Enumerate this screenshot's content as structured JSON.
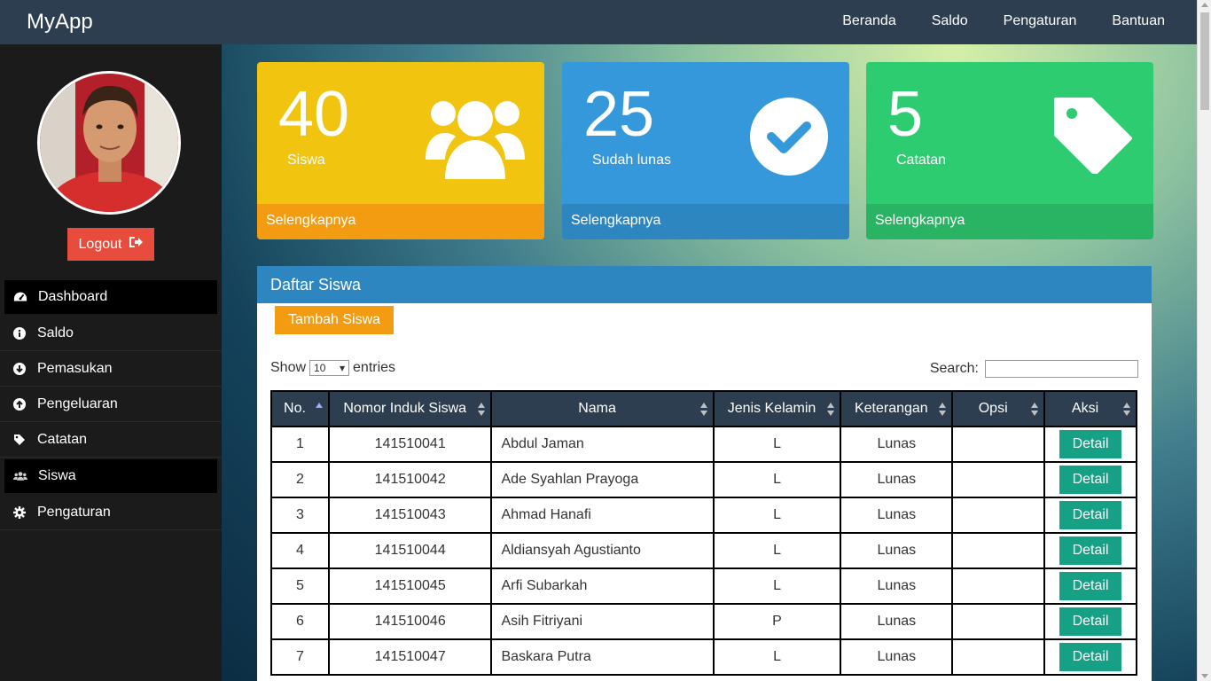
{
  "app": {
    "brand": "MyApp"
  },
  "topnav": [
    "Beranda",
    "Saldo",
    "Pengaturan",
    "Bantuan"
  ],
  "sidebar": {
    "logout_label": "Logout",
    "items": [
      {
        "label": "Dashboard",
        "icon": "dashboard-icon",
        "active": true
      },
      {
        "label": "Saldo",
        "icon": "info-icon",
        "active": false
      },
      {
        "label": "Pemasukan",
        "icon": "arrow-down-circle-icon",
        "active": false
      },
      {
        "label": "Pengeluaran",
        "icon": "arrow-up-circle-icon",
        "active": false
      },
      {
        "label": "Catatan",
        "icon": "tag-icon",
        "active": false
      },
      {
        "label": "Siswa",
        "icon": "users-icon",
        "active": true
      },
      {
        "label": "Pengaturan",
        "icon": "gear-icon",
        "active": false
      }
    ]
  },
  "stats": [
    {
      "value": "40",
      "label": "Siswa",
      "footer": "Selengkapnya",
      "icon": "users-icon",
      "color": "#f1c40f"
    },
    {
      "value": "25",
      "label": "Sudah lunas",
      "footer": "Selengkapnya",
      "icon": "check-circle-icon",
      "color": "#3498db"
    },
    {
      "value": "5",
      "label": "Catatan",
      "footer": "Selengkapnya",
      "icon": "tag-icon",
      "color": "#2ecc71"
    }
  ],
  "panel": {
    "title": "Daftar Siswa",
    "add_button": "Tambah Siswa",
    "show_label": "Show",
    "entries_value": "10",
    "entries_label": "entries",
    "search_label": "Search:",
    "search_value": ""
  },
  "table": {
    "columns": [
      "No.",
      "Nomor Induk Siswa",
      "Nama",
      "Jenis Kelamin",
      "Keterangan",
      "Opsi",
      "Aksi"
    ],
    "detail_label": "Detail",
    "rows": [
      [
        "1",
        "141510041",
        "Abdul Jaman",
        "L",
        "Lunas",
        ""
      ],
      [
        "2",
        "141510042",
        "Ade Syahlan Prayoga",
        "L",
        "Lunas",
        ""
      ],
      [
        "3",
        "141510043",
        "Ahmad Hanafi",
        "L",
        "Lunas",
        ""
      ],
      [
        "4",
        "141510044",
        "Aldiansyah Agustianto",
        "L",
        "Lunas",
        ""
      ],
      [
        "5",
        "141510045",
        "Arfi Subarkah",
        "L",
        "Lunas",
        ""
      ],
      [
        "6",
        "141510046",
        "Asih Fitriyani",
        "P",
        "Lunas",
        ""
      ],
      [
        "7",
        "141510047",
        "Baskara Putra",
        "L",
        "Lunas",
        ""
      ]
    ]
  }
}
